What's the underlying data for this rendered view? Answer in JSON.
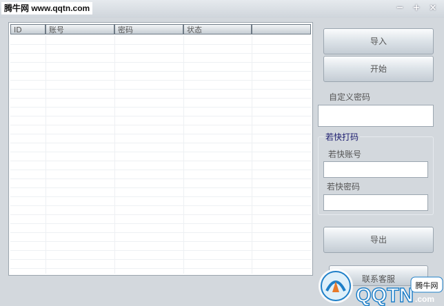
{
  "window": {
    "watermark": "腾牛网 www.qqtn.com",
    "minimize_glyph": "−",
    "maximize_glyph": "+",
    "close_glyph": "×"
  },
  "table": {
    "columns": [
      "ID",
      "账号",
      "密码",
      "状态",
      ""
    ]
  },
  "buttons": {
    "import": "导入",
    "start": "开始",
    "export": "导出",
    "contact": "联系客服"
  },
  "custom_password": {
    "label": "自定义密码",
    "value": ""
  },
  "quick_group": {
    "title": "若快打码",
    "account_label": "若快账号",
    "account_value": "",
    "password_label": "若快密码",
    "password_value": ""
  },
  "logo": {
    "text": "QQTN",
    "dotcom": ".com",
    "badge": "腾牛网"
  },
  "colors": {
    "brand_blue": "#1e7fc8",
    "background": "#d3d8dd"
  }
}
